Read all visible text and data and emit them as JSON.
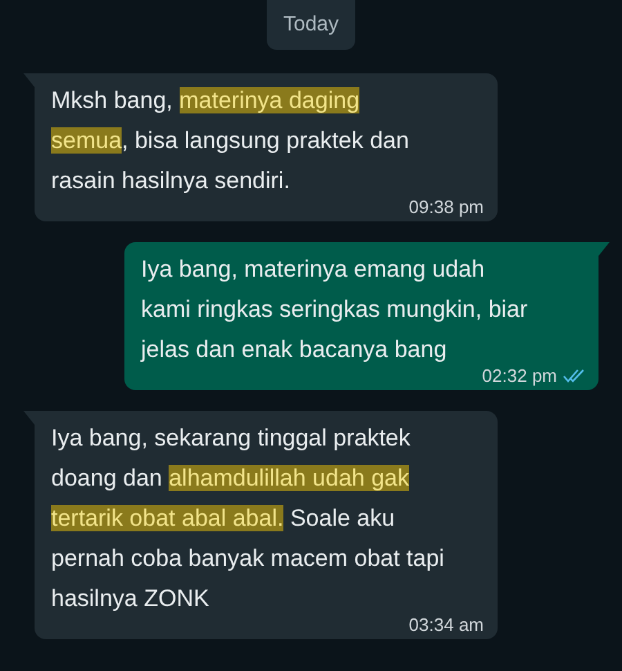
{
  "date_chip": "Today",
  "messages": [
    {
      "kind": "incoming",
      "segments": [
        {
          "text": "Mksh bang, ",
          "highlighted": false
        },
        {
          "text": "materinya daging\nsemua",
          "highlighted": true
        },
        {
          "text": ", bisa langsung praktek dan\nrasain hasilnya sendiri.",
          "highlighted": false
        }
      ],
      "time": "09:38 pm",
      "read": false
    },
    {
      "kind": "outgoing",
      "segments": [
        {
          "text": "Iya bang, materinya emang udah\nkami ringkas seringkas mungkin, biar\njelas dan enak bacanya bang",
          "highlighted": false
        }
      ],
      "time": "02:32 pm",
      "read": true
    },
    {
      "kind": "incoming",
      "segments": [
        {
          "text": "Iya bang, sekarang tinggal praktek\ndoang dan ",
          "highlighted": false
        },
        {
          "text": "alhamdulillah udah gak\ntertarik obat abal abal.",
          "highlighted": true
        },
        {
          "text": " Soale aku\npernah coba banyak macem obat tapi\nhasilnya ZONK",
          "highlighted": false
        }
      ],
      "time": "03:34 am",
      "read": false
    }
  ]
}
